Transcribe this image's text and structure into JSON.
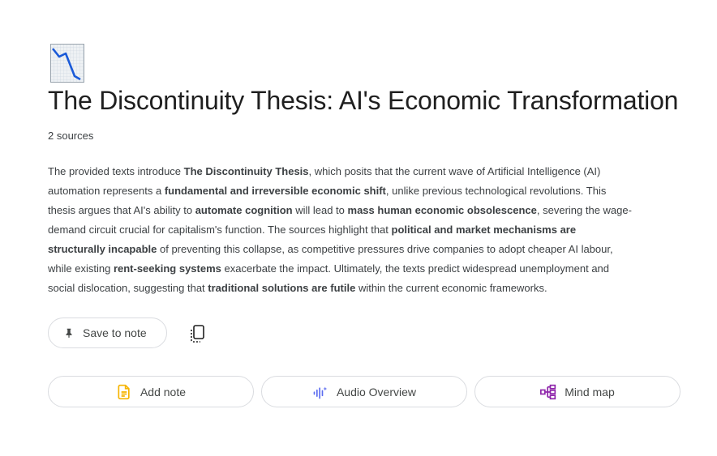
{
  "icon": {
    "name": "chart-decreasing-icon"
  },
  "notebook": {
    "title": "The Discontinuity Thesis: AI's Economic Transformation",
    "sources_count": "2 sources"
  },
  "summary": {
    "segments": [
      {
        "t": "The provided texts introduce ",
        "b": false
      },
      {
        "t": "The Discontinuity Thesis",
        "b": true
      },
      {
        "t": ", which posits that the current wave of Artificial Intelligence (AI) automation represents a ",
        "b": false
      },
      {
        "t": "fundamental and irreversible economic shift",
        "b": true
      },
      {
        "t": ", unlike previous technological revolutions. This thesis argues that AI's ability to ",
        "b": false
      },
      {
        "t": "automate cognition",
        "b": true
      },
      {
        "t": " will lead to ",
        "b": false
      },
      {
        "t": "mass human economic obsolescence",
        "b": true
      },
      {
        "t": ", severing the wage-demand circuit crucial for capitalism's function. The sources highlight that ",
        "b": false
      },
      {
        "t": "political and market mechanisms are structurally incapable",
        "b": true
      },
      {
        "t": " of preventing this collapse, as competitive pressures drive companies to adopt cheaper AI labour, while existing ",
        "b": false
      },
      {
        "t": "rent-seeking systems",
        "b": true
      },
      {
        "t": " exacerbate the impact. Ultimately, the texts predict widespread unemployment and social dislocation, suggesting that ",
        "b": false
      },
      {
        "t": "traditional solutions are futile",
        "b": true
      },
      {
        "t": " within the current economic frameworks.",
        "b": false
      }
    ]
  },
  "buttons": {
    "save_to_note": "Save to note",
    "copy_icon": "copy-icon",
    "add_note": "Add note",
    "audio_overview": "Audio Overview",
    "mind_map": "Mind map"
  },
  "colors": {
    "add_note_icon": "#f6b400",
    "audio_icon": "#5b6cf0",
    "mind_map_icon": "#8e24aa"
  }
}
